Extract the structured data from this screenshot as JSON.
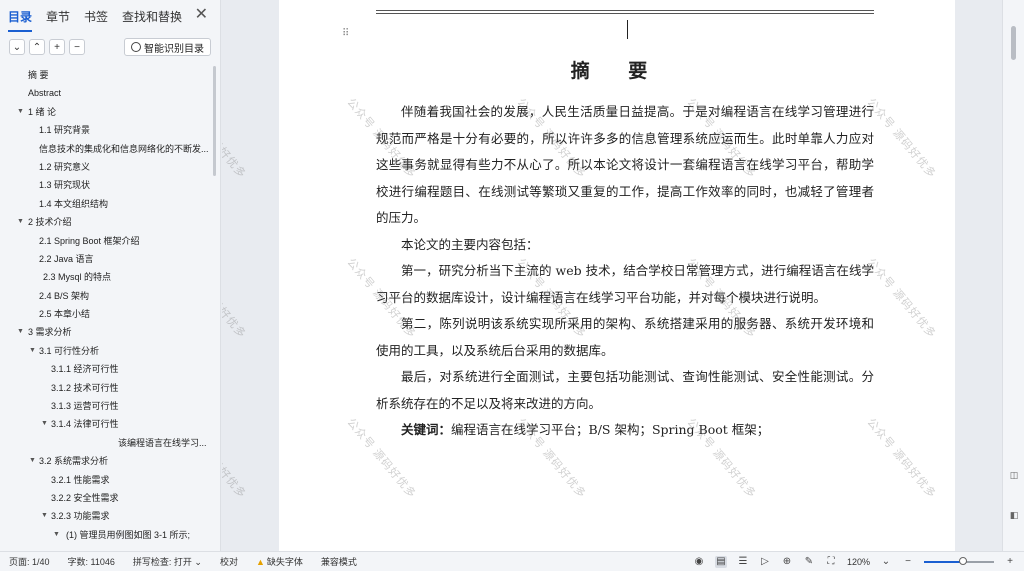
{
  "sidebar": {
    "tabs": [
      {
        "label": "目录",
        "active": true
      },
      {
        "label": "章节",
        "active": false
      },
      {
        "label": "书签",
        "active": false
      },
      {
        "label": "查找和替换",
        "active": false
      }
    ],
    "tools": {
      "collapse": "⌄",
      "expand": "⌃",
      "add": "+",
      "remove": "−",
      "smart_label": "智能识别目录"
    },
    "toc": [
      {
        "label": "摘  要",
        "level": 1,
        "arrow": ""
      },
      {
        "label": "Abstract",
        "level": 1,
        "arrow": ""
      },
      {
        "label": "1 绪  论",
        "level": 1,
        "arrow": "▼"
      },
      {
        "label": "1.1 研究背景",
        "level": 2,
        "arrow": ""
      },
      {
        "label": "信息技术的集成化和信息网络化的不断发...",
        "level": 2,
        "arrow": ""
      },
      {
        "label": "1.2  研究意义",
        "level": 2,
        "arrow": ""
      },
      {
        "label": "1.3 研究现状",
        "level": 2,
        "arrow": ""
      },
      {
        "label": "1.4 本文组织结构",
        "level": 2,
        "arrow": ""
      },
      {
        "label": "2  技术介绍",
        "level": 1,
        "arrow": "▼"
      },
      {
        "label": "2.1 Spring Boot 框架介绍",
        "level": 2,
        "arrow": ""
      },
      {
        "label": "2.2 Java 语言",
        "level": 2,
        "arrow": ""
      },
      {
        "label": "2.3 Mysql 的特点",
        "level": 2.3,
        "arrow": ""
      },
      {
        "label": "2.4 B/S 架构",
        "level": 2,
        "arrow": ""
      },
      {
        "label": "2.5 本章小结",
        "level": 2,
        "arrow": ""
      },
      {
        "label": "3 需求分析",
        "level": 1,
        "arrow": "▼"
      },
      {
        "label": "3.1 可行性分析",
        "level": 2,
        "arrow": "▼"
      },
      {
        "label": "3.1.1 经济可行性",
        "level": 3,
        "arrow": ""
      },
      {
        "label": "3.1.2 技术可行性",
        "level": 3,
        "arrow": ""
      },
      {
        "label": "3.1.3 运营可行性",
        "level": 3,
        "arrow": ""
      },
      {
        "label": "3.1.4 法律可行性",
        "level": 3,
        "arrow": "▼"
      },
      {
        "label": "该编程语言在线学习...",
        "level": 5,
        "arrow": ""
      },
      {
        "label": "3.2 系统需求分析",
        "level": 2,
        "arrow": "▼"
      },
      {
        "label": "3.2.1  性能需求",
        "level": 3,
        "arrow": ""
      },
      {
        "label": "3.2.2  安全性需求",
        "level": 3,
        "arrow": ""
      },
      {
        "label": "3.2.3 功能需求",
        "level": 3,
        "arrow": "▼"
      },
      {
        "label": "(1)  管理员用例图如图 3-1 所示;",
        "level": 4,
        "arrow": "▼"
      }
    ]
  },
  "document": {
    "title": "摘  要",
    "paragraphs": [
      "伴随着我国社会的发展，人民生活质量日益提高。于是对编程语言在线学习管理进行规范而严格是十分有必要的，所以许许多多的信息管理系统应运而生。此时单靠人力应对这些事务就显得有些力不从心了。所以本论文将设计一套编程语言在线学习平台，帮助学校进行编程题目、在线测试等繁琐又重复的工作，提高工作效率的同时，也减轻了管理者的压力。",
      "本论文的主要内容包括：",
      "第一，研究分析当下主流的 web 技术，结合学校日常管理方式，进行编程语言在线学习平台的数据库设计，设计编程语言在线学习平台功能，并对每个模块进行说明。",
      "第二，陈列说明该系统实现所采用的架构、系统搭建采用的服务器、系统开发环境和使用的工具，以及系统后台采用的数据库。",
      "最后，对系统进行全面测试，主要包括功能测试、查询性能测试、安全性能测试。分析系统存在的不足以及将来改进的方向。"
    ],
    "keywords_label": "关键词：",
    "keywords": "编程语言在线学习平台；B/S 架构；Spring Boot 框架；",
    "watermark": "公众号 源码好优多"
  },
  "statusbar": {
    "page": "页面: 1/40",
    "words": "字数: 11046",
    "spellcheck": "拼写检查: 打开 ⌄",
    "proofread": "校对",
    "missing_font": "缺失字体",
    "compat_mode": "兼容模式",
    "zoom": "120%",
    "zoom_fraction": 0.55
  }
}
